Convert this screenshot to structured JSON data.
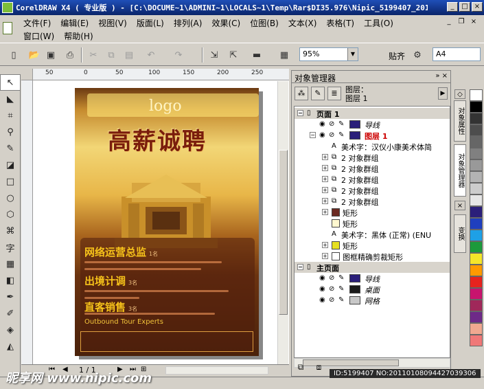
{
  "window": {
    "title": "CorelDRAW X4 ( 专业版 ) - [C:\\DOCUME~1\\ADMINI~1\\LOCALS~1\\Temp\\Rar$DI35.976\\Nipic_5199407_201101...",
    "buttons": [
      "_",
      "□",
      "×"
    ]
  },
  "menu": {
    "row1": [
      "文件(F)",
      "编辑(E)",
      "视图(V)",
      "版面(L)",
      "排列(A)",
      "效果(C)",
      "位图(B)",
      "文本(X)",
      "表格(T)",
      "工具(O)"
    ],
    "row2": [
      "窗口(W)",
      "帮助(H)"
    ]
  },
  "toolbar": {
    "zoom": "95%",
    "snap": "贴齐",
    "page_size": "A4"
  },
  "ruler": {
    "labels": [
      "50",
      "0",
      "50",
      "100",
      "150",
      "200",
      "250"
    ]
  },
  "poster": {
    "logo": "logo",
    "headline": "高薪诚聘",
    "sections": [
      {
        "title": "网络运营总监",
        "sub": "1名"
      },
      {
        "title": "出境计调",
        "sub": "3名"
      },
      {
        "title": "直客销售",
        "sub": "3名"
      }
    ],
    "en_title": "Outbound Tour Experts"
  },
  "page_nav": {
    "page": "1 / 1"
  },
  "docker": {
    "title": "对象管理器",
    "current_layer_label": "图层：",
    "current_layer_value": "图层 1",
    "tree": [
      {
        "text": "页面 1",
        "level": 0,
        "type": "section"
      },
      {
        "text": "导线",
        "level": 1,
        "type": "layer",
        "color": "#2b1f7a"
      },
      {
        "text": "图层 1",
        "level": 1,
        "type": "selected",
        "color": "#2b1f7a"
      },
      {
        "text": "美术字：汉仪小康美术体简",
        "level": 2,
        "type": "text"
      },
      {
        "text": "2 对象群组",
        "level": 2,
        "type": "group"
      },
      {
        "text": "2 对象群组",
        "level": 2,
        "type": "group"
      },
      {
        "text": "2 对象群组",
        "level": 2,
        "type": "group"
      },
      {
        "text": "2 对象群组",
        "level": 2,
        "type": "group"
      },
      {
        "text": "2 对象群组",
        "level": 2,
        "type": "group"
      },
      {
        "text": "矩形",
        "level": 2,
        "type": "rect",
        "color": "#6b2a22"
      },
      {
        "text": "矩形",
        "level": 2,
        "type": "rect",
        "color": "#fff8d0"
      },
      {
        "text": "美术字：黑体 (正常) (ENU",
        "level": 2,
        "type": "text"
      },
      {
        "text": "矩形",
        "level": 2,
        "type": "rect",
        "color": "#e6e020"
      },
      {
        "text": "图框精确剪裁矩形",
        "level": 2,
        "type": "rect",
        "color": "#ffffff"
      },
      {
        "text": "主页面",
        "level": 0,
        "type": "section"
      },
      {
        "text": "导线",
        "level": 1,
        "type": "layer",
        "color": "#2b1f7a"
      },
      {
        "text": "桌面",
        "level": 1,
        "type": "layer",
        "color": "#1a1a1a"
      },
      {
        "text": "网格",
        "level": 1,
        "type": "layer",
        "color": "#c8c8c8"
      }
    ]
  },
  "dock_tabs": [
    "对象属性",
    "对象管理器",
    "变换"
  ],
  "palette": [
    "#ffffff",
    "#000000",
    "#333333",
    "#4d4d4d",
    "#666666",
    "#808080",
    "#999999",
    "#b3b3b3",
    "#cccccc",
    "#e6e6e6",
    "#2b1f7a",
    "#1f3fbf",
    "#1ea0e6",
    "#1c9a3c",
    "#f5e62a",
    "#ff9a00",
    "#e6231e",
    "#c8146e",
    "#a0285a",
    "#6e2a88",
    "#f0a890",
    "#f07878"
  ],
  "watermark": {
    "left": "昵享网 www.nipic.com",
    "right": "ID:5199407 NO:20110108094427039306"
  }
}
